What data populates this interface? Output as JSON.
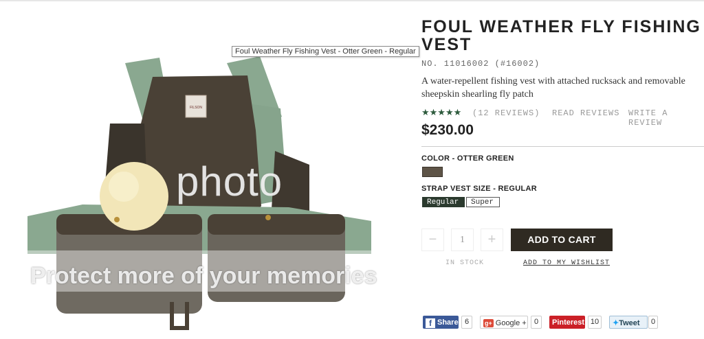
{
  "image": {
    "tooltip": "Foul Weather Fly Fishing Vest - Otter Green - Regular",
    "watermark_top": "photo",
    "watermark_bottom": "Protect more of your memories",
    "patch_label": "FILSON"
  },
  "product": {
    "title": "FOUL WEATHER FLY FISHING VEST",
    "sku": "NO. 11016002 (#16002)",
    "description": "A water-repellent fishing vest with attached rucksack and removable sheepskin shearling fly patch",
    "stars": "★★★★★",
    "reviews_count": "(12 REVIEWS)",
    "read_reviews": "READ REVIEWS",
    "write_review": "WRITE A REVIEW",
    "price": "$230.00"
  },
  "options": {
    "color_label": "COLOR - OTTER GREEN",
    "swatch_color": "#5e5447",
    "size_label": "STRAP VEST SIZE - REGULAR",
    "sizes": [
      "Regular",
      "Super"
    ]
  },
  "purchase": {
    "minus": "−",
    "quantity": "1",
    "plus": "+",
    "add_to_cart": "ADD TO CART",
    "stock": "IN STOCK",
    "wishlist": "ADD TO MY WISHLIST"
  },
  "share": {
    "facebook_label": "Share",
    "facebook_count": "6",
    "google_badge": "g+",
    "google_label": "Google +",
    "google_count": "0",
    "pinterest_label": "Pinterest",
    "pinterest_count": "10",
    "twitter_label": "Tweet",
    "twitter_count": "0"
  }
}
